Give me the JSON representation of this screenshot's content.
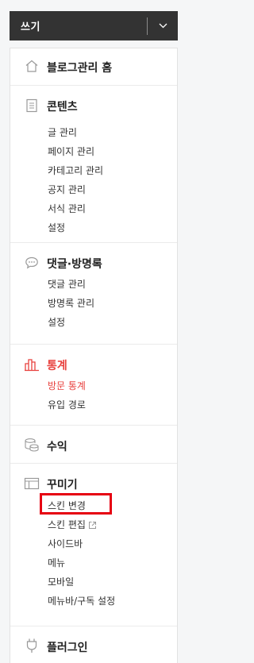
{
  "write_button": {
    "label": "쓰기"
  },
  "menu": {
    "home": {
      "title": "블로그관리 홈"
    },
    "contents": {
      "title": "콘텐츠",
      "items": [
        "글 관리",
        "페이지 관리",
        "카테고리 관리",
        "공지 관리",
        "서식 관리",
        "설정"
      ]
    },
    "comments": {
      "title": "댓글·방명록",
      "items": [
        "댓글 관리",
        "방명록 관리",
        "설정"
      ]
    },
    "stats": {
      "title": "통계",
      "items": [
        "방문 통계",
        "유입 경로"
      ],
      "active_item": "방문 통계"
    },
    "revenue": {
      "title": "수익"
    },
    "decorate": {
      "title": "꾸미기",
      "items": [
        "스킨 변경",
        "스킨 편집",
        "사이드바",
        "메뉴",
        "모바일",
        "메뉴바/구독 설정"
      ]
    },
    "plugins": {
      "title": "플러그인"
    }
  },
  "colors": {
    "accent": "#e8413e",
    "highlight_box": "#e60012",
    "write_bg": "#333333"
  },
  "icons": {
    "home": "home-icon",
    "contents": "document-icon",
    "comments": "speech-bubble-icon",
    "stats": "bar-chart-icon",
    "revenue": "coins-icon",
    "decorate": "layout-icon",
    "plugins": "plug-icon",
    "external": "external-link-icon",
    "dropdown": "chevron-down-icon"
  }
}
